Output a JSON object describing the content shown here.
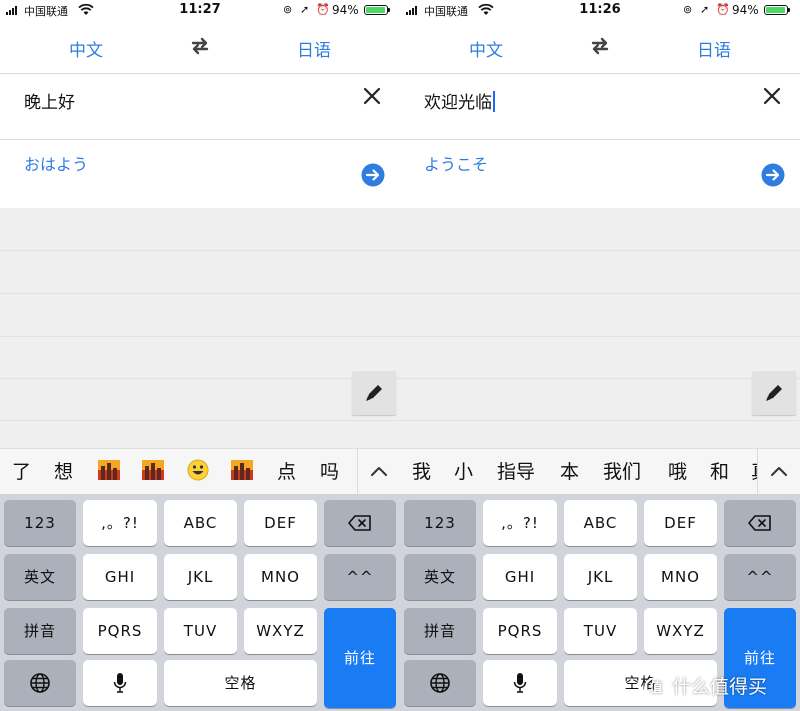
{
  "colors": {
    "accent": "#2f7de0",
    "go_key": "#1a7cf5",
    "battery": "#4cd964",
    "keyboard_bg": "#d1d4da",
    "fn_key": "#abb0ba"
  },
  "left": {
    "status": {
      "carrier": "中国联通",
      "time": "11:27",
      "battery": "94%",
      "battery_level": 0.94
    },
    "source_lang": "中文",
    "target_lang": "日语",
    "input_text": "晚上好",
    "output_text": "おはよう",
    "candidates": [
      "了",
      "想",
      "🌇",
      "🌇",
      "😃",
      "🌇",
      "点",
      "吗"
    ]
  },
  "right": {
    "status": {
      "carrier": "中国联通",
      "time": "11:26",
      "battery": "94%",
      "battery_level": 0.94
    },
    "source_lang": "中文",
    "target_lang": "日语",
    "input_text": "欢迎光临",
    "output_text": "ようこそ",
    "candidates": [
      "我",
      "小",
      "指导",
      "本",
      "我们",
      "哦",
      "和",
      "真"
    ]
  },
  "keys": {
    "num": "123",
    "punct": ",。?!",
    "abc": "ABC",
    "def": "DEF",
    "english": "英文",
    "ghi": "GHI",
    "jkl": "JKL",
    "mno": "MNO",
    "face": "^^",
    "pinyin": "拼音",
    "pqrs": "PQRS",
    "tuv": "TUV",
    "wxyz": "WXYZ",
    "space": "空格",
    "go": "前往"
  },
  "icons": {
    "swap": "swap-arrows-icon",
    "clear": "close-icon",
    "go": "arrow-right-circle-icon",
    "handwrite": "pen-icon",
    "backspace": "backspace-icon",
    "globe": "globe-icon",
    "mic": "microphone-icon",
    "chevron": "chevron-up-icon"
  },
  "watermark": {
    "badge": "值",
    "text": "什么值得买"
  }
}
